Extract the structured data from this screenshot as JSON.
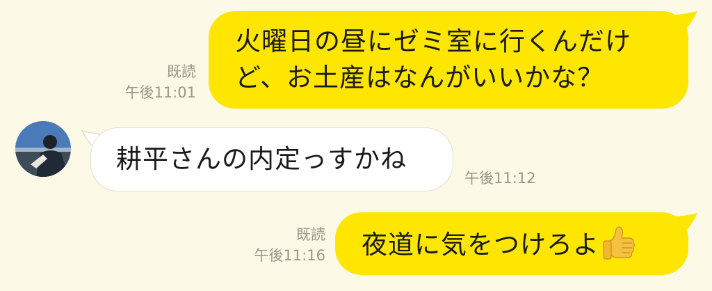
{
  "messages": [
    {
      "direction": "outgoing",
      "lines": [
        "火曜日の昼にゼミ室に行くんだけ",
        "ど、お土産はなんがいいかな？"
      ],
      "read": "既読",
      "time": "午後11:01"
    },
    {
      "direction": "incoming",
      "lines": [
        "耕平さんの内定っすかね"
      ],
      "time": "午後11:12"
    },
    {
      "direction": "outgoing",
      "lines": [
        "夜道に気をつけろよ"
      ],
      "emoji": "thumbs-up",
      "read": "既読",
      "time": "午後11:16"
    }
  ],
  "colors": {
    "background": "#fcf9e6",
    "outgoing_bubble": "#fee600",
    "incoming_bubble": "#ffffff",
    "meta_text": "#9a9686"
  }
}
